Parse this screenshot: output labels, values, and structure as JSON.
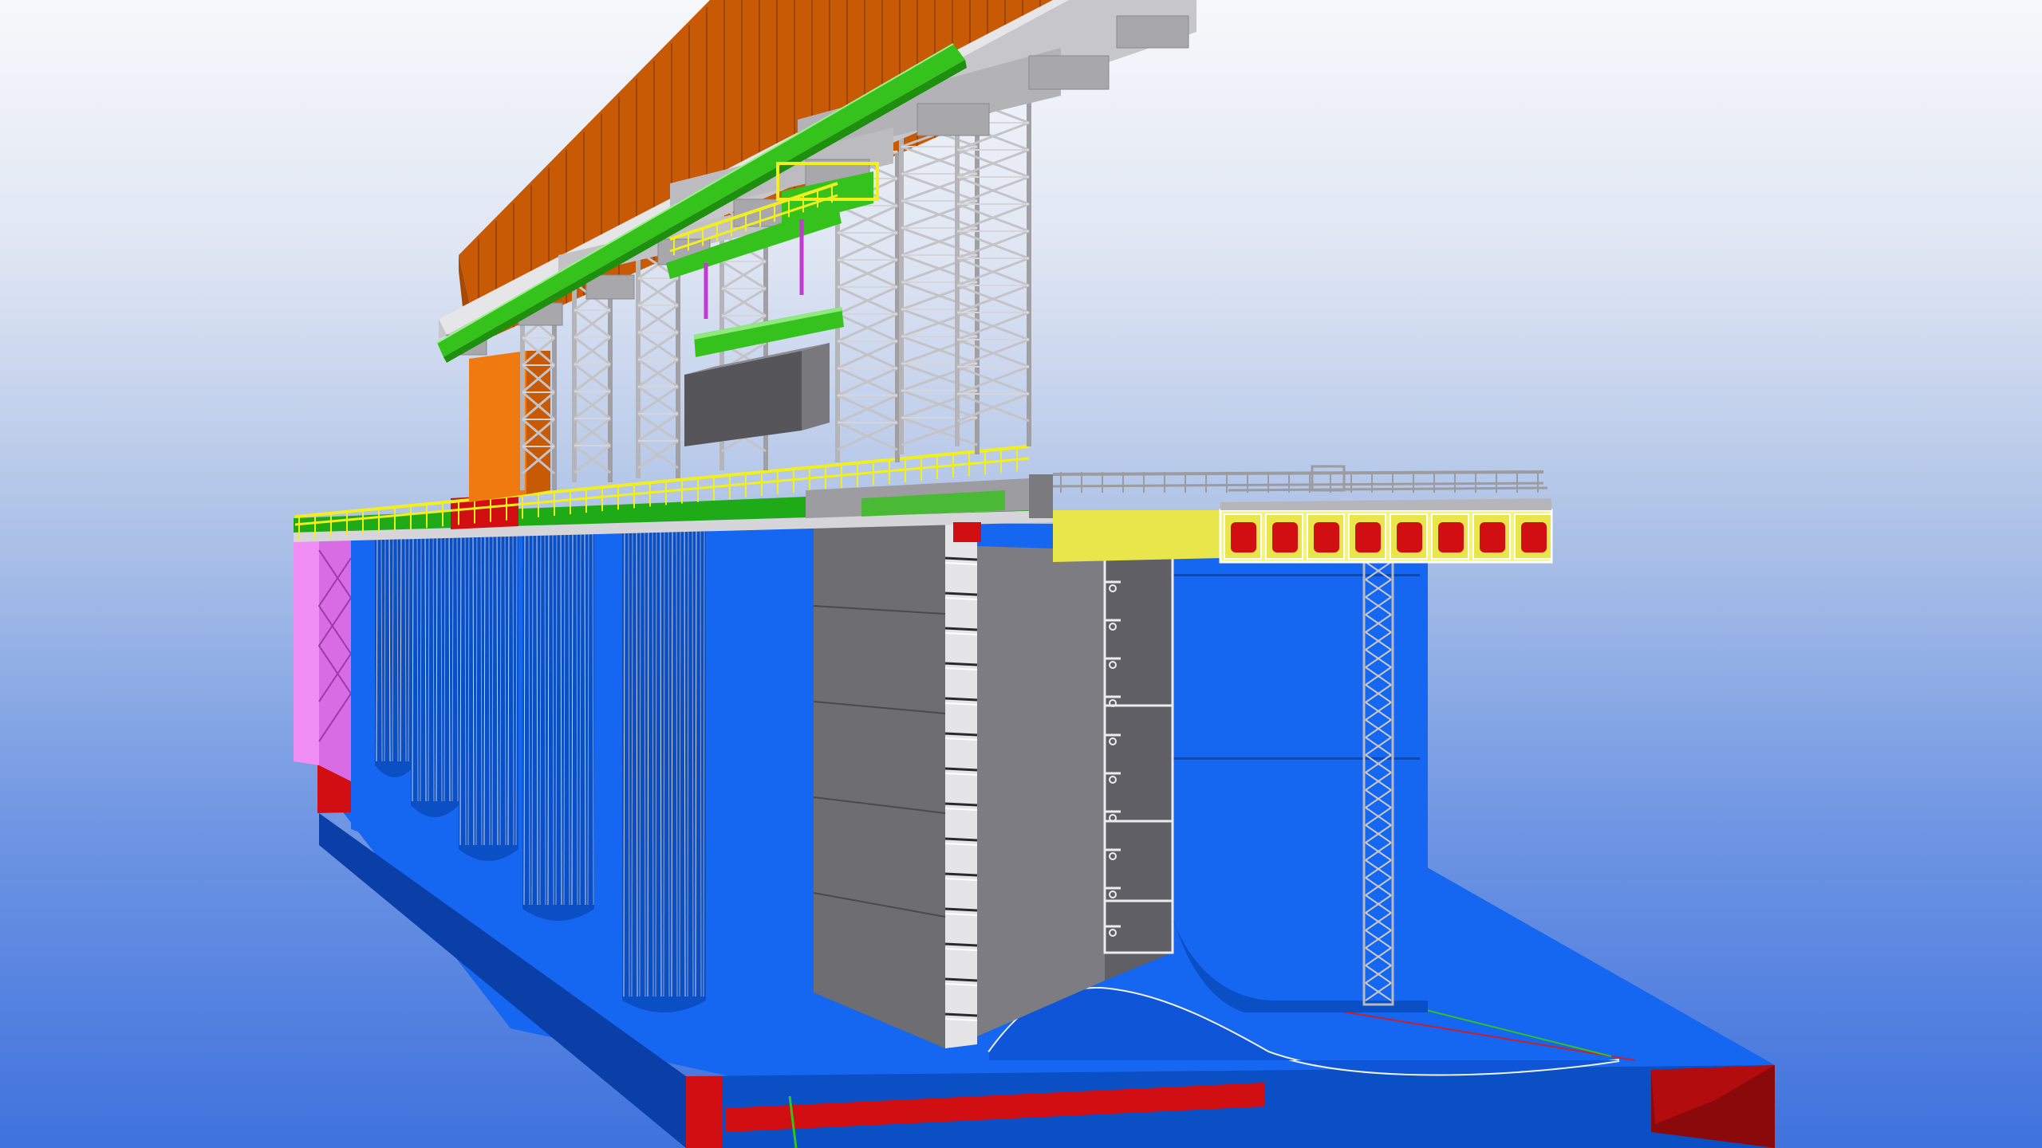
{
  "viewport": {
    "kind": "3d-model-view",
    "background": {
      "top": "#f7f8fb",
      "middle": "#a9bfe6",
      "bottom": "#3f72dd"
    }
  },
  "model": {
    "colors": {
      "hull_blue": "#1566f0",
      "hull_blue_dark": "#0a4fc4",
      "hull_side": "#0b3fa8",
      "red_band": "#d10f12",
      "red_dark": "#8a0a0c",
      "magenta": "#e77cf0",
      "gantry_orange": "#c85a05",
      "column_orange": "#f07a10",
      "steel_grey": "#a9a9ad",
      "steel_light": "#d6d6da",
      "cassette_grey": "#6d6d72",
      "cassette_dark": "#4a4a4f",
      "rail_green": "#36c21c",
      "rail_green_dark": "#1f8f10",
      "handrail_yellow": "#f2ef1e",
      "deck_yellow": "#e8e64a",
      "hoist_purple": "#c33ad0"
    },
    "tank_count": 5,
    "deck_red_box_count": 8,
    "hoist_cable_count": 2
  }
}
